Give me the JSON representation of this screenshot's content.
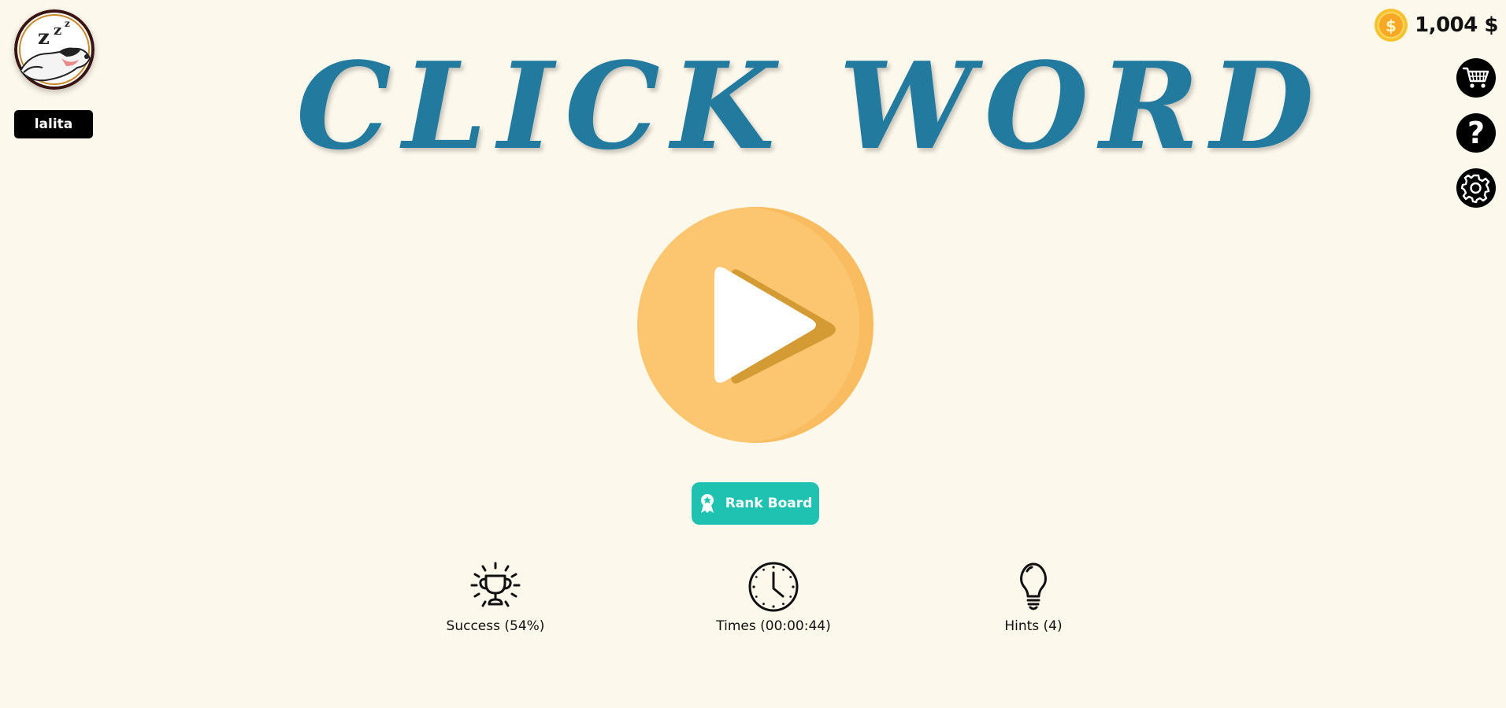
{
  "profile": {
    "username": "lalita",
    "avatar_icon": "sleeping-dog-avatar"
  },
  "wallet": {
    "amount": "1,004 $",
    "icon": "gold-coin-icon"
  },
  "side_buttons": [
    {
      "name": "shop",
      "icon": "cart-icon"
    },
    {
      "name": "help",
      "icon": "question-icon"
    },
    {
      "name": "settings",
      "icon": "gear-icon"
    }
  ],
  "title": "CLICK WORD",
  "play": {
    "icon": "play-icon"
  },
  "rank_board": {
    "label": "Rank Board",
    "icon": "award-icon"
  },
  "stats": {
    "success": "Success (54%)",
    "times": "Times (00:00:44)",
    "hints": "Hints (4)"
  },
  "colors": {
    "background": "#fdf8ec",
    "title": "#237a9f",
    "play_button": "#fcc670",
    "rank_button": "#1fc2b0",
    "coin": "#f7c22d"
  }
}
